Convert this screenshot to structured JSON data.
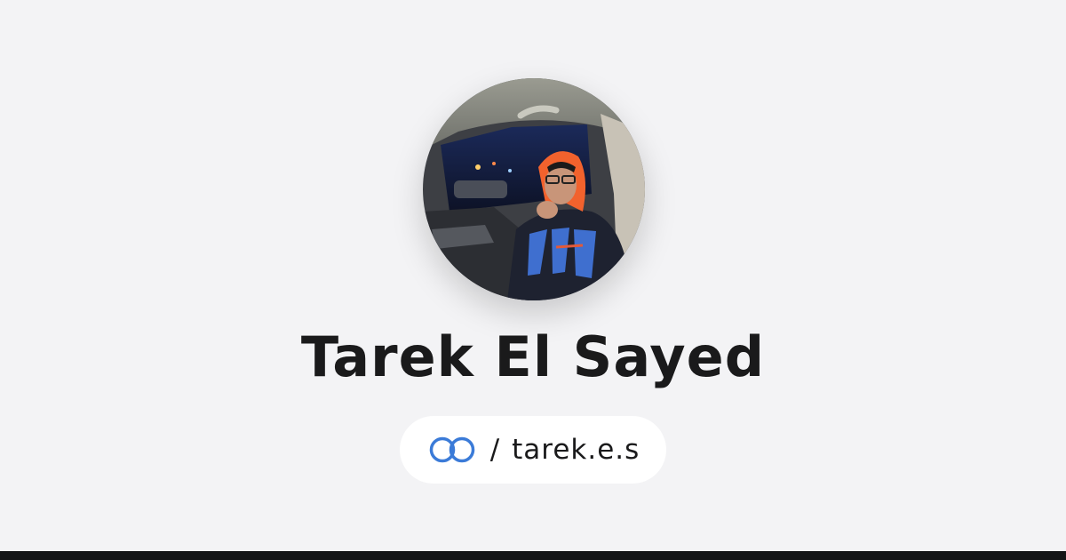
{
  "profile": {
    "name": "Tarek El Sayed",
    "handle": "tarek.e.s",
    "separator": "/"
  },
  "icons": {
    "link": "linked-rings-icon",
    "avatar": "profile-photo"
  },
  "colors": {
    "background": "#f3f3f5",
    "text": "#1a1a1b",
    "accent": "#3b7bd8",
    "pill": "#ffffff",
    "bottom_bar": "#151617"
  }
}
